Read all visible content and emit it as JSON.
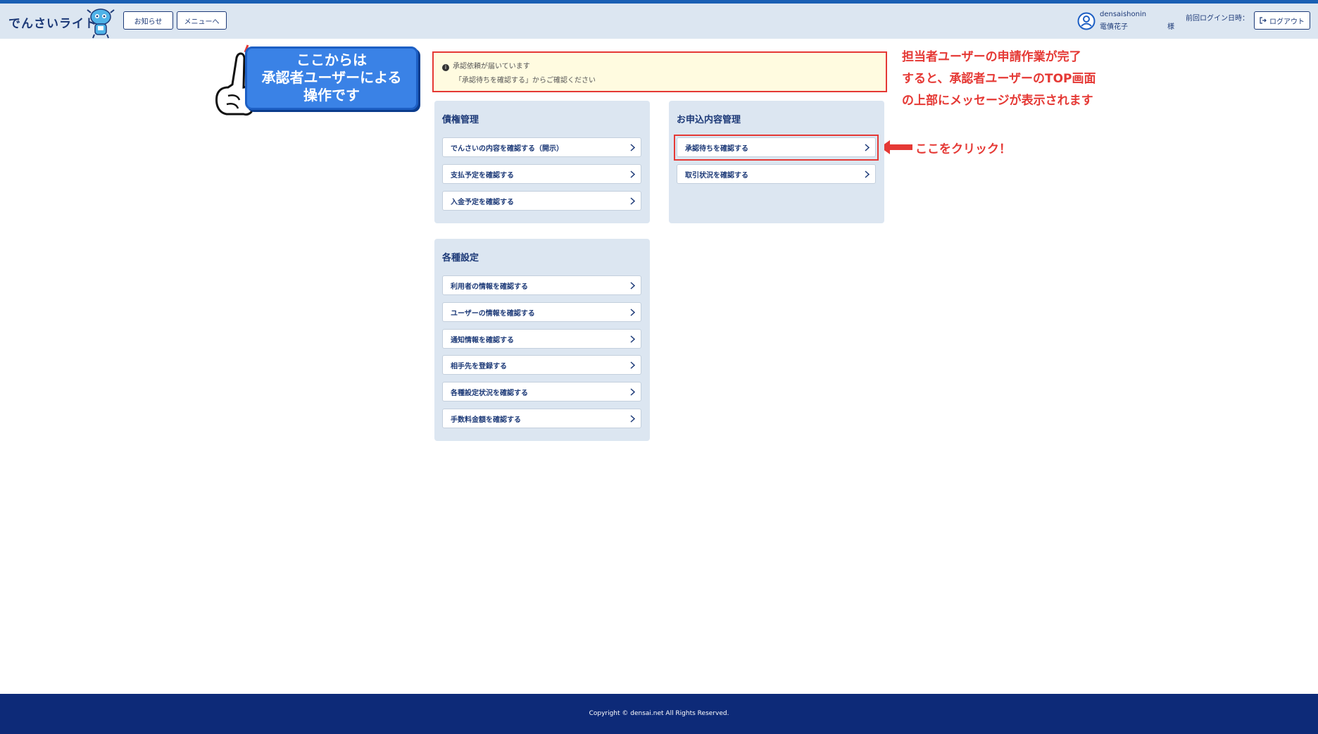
{
  "header": {
    "logo": "でんさいライト",
    "news_label": "お知らせ",
    "menu_label": "メニューへ",
    "user_id": "densaishonin",
    "user_name": "電債花子",
    "sama": "様",
    "last_login_label": "前回ログイン日時：",
    "logout_label": "ログアウト"
  },
  "callout": {
    "line1": "ここからは",
    "line2": "承認者ユーザーによる",
    "line3": "操作です"
  },
  "notice": {
    "line1": "承認依頼が届いています",
    "line2": "「承認待ちを確認する」からご確認ください"
  },
  "annotation": {
    "line1": "担当者ユーザーの申請作業が完了",
    "line2": "すると、承認者ユーザーのTOP画面",
    "line3": "の上部にメッセージが表示されます",
    "click": "ここをクリック！"
  },
  "panels": {
    "claims": {
      "title": "債権管理",
      "items": [
        "でんさいの内容を確認する（開示）",
        "支払予定を確認する",
        "入金予定を確認する"
      ]
    },
    "applications": {
      "title": "お申込内容管理",
      "items": [
        "承認待ちを確認する",
        "取引状況を確認する"
      ]
    },
    "settings": {
      "title": "各種設定",
      "items": [
        "利用者の情報を確認する",
        "ユーザーの情報を確認する",
        "通知情報を確認する",
        "相手先を登録する",
        "各種設定状況を確認する",
        "手数料金額を確認する"
      ]
    }
  },
  "footer": {
    "copyright": "Copyright © densai.net All Rights Reserved."
  },
  "colors": {
    "header_bg": "#dce6f1",
    "brand_navy": "#1d3a78",
    "footer_bg": "#0d2a78",
    "annotation_red": "#e53935",
    "callout_blue": "#3a82e6"
  }
}
